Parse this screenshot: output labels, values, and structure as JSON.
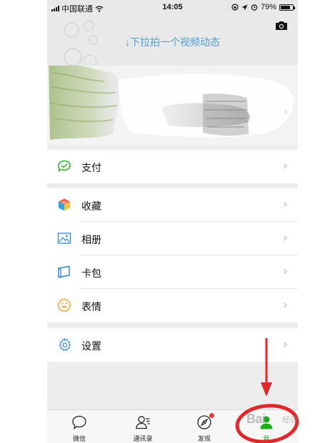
{
  "status_bar": {
    "carrier": "中国联通",
    "time": "14:05",
    "battery": "79%",
    "battery_level": 0.79
  },
  "header": {
    "pull_hint": "↓下拉拍一个视频动态",
    "camera_icon": "camera-icon"
  },
  "menu": {
    "pay": {
      "label": "支付",
      "icon": "pay-icon"
    },
    "favorites": {
      "label": "收藏",
      "icon": "favorites-cube-icon"
    },
    "album": {
      "label": "相册",
      "icon": "album-image-icon"
    },
    "cards": {
      "label": "卡包",
      "icon": "card-wallet-icon"
    },
    "stickers": {
      "label": "表情",
      "icon": "smiley-icon"
    },
    "settings": {
      "label": "设置",
      "icon": "gear-icon"
    }
  },
  "tabs": [
    {
      "label": "微信",
      "icon": "chat-bubble-icon",
      "active": false
    },
    {
      "label": "通讯录",
      "icon": "contacts-icon",
      "active": false
    },
    {
      "label": "发现",
      "icon": "compass-icon",
      "active": false,
      "badge": true
    },
    {
      "label": "我",
      "icon": "person-icon",
      "active": true
    }
  ],
  "colors": {
    "accent_green": "#1aad19",
    "hint_blue": "#4a9fd1",
    "annotation_red": "#e3262b",
    "badge_red": "#f43530"
  },
  "watermark": {
    "brand": "Bai",
    "sub": "经验"
  }
}
